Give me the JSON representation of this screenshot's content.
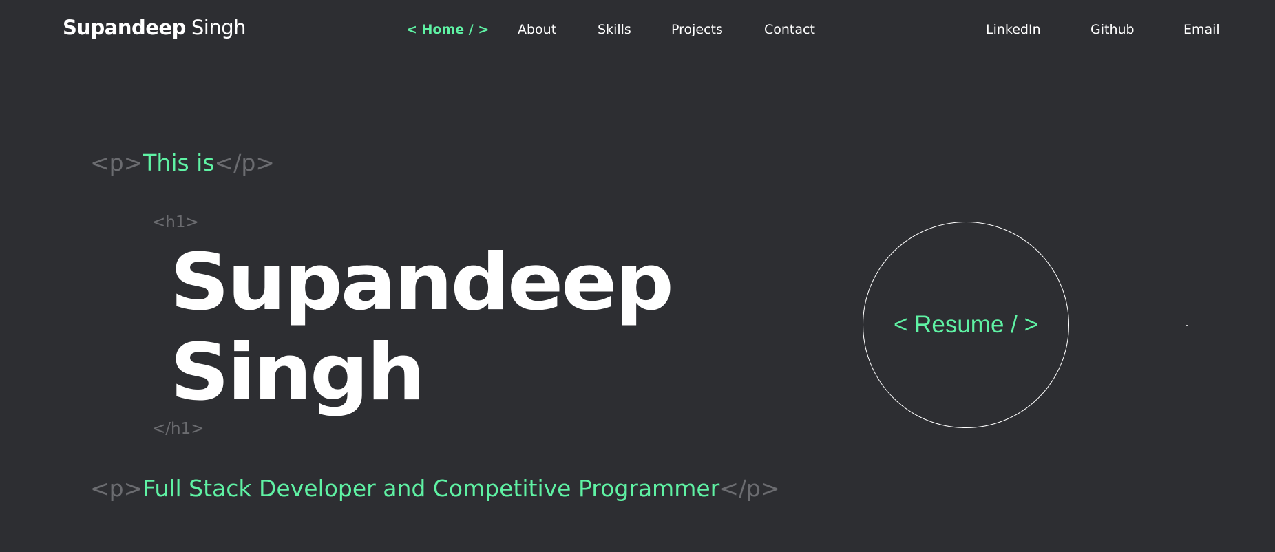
{
  "nav": {
    "brand_first": "Supandeep",
    "brand_last": "Singh",
    "links": [
      {
        "label": "< Home / >"
      },
      {
        "label": "About"
      },
      {
        "label": "Skills"
      },
      {
        "label": "Projects"
      },
      {
        "label": "Contact"
      }
    ],
    "social": [
      {
        "label": "LinkedIn"
      },
      {
        "label": "Github"
      },
      {
        "label": "Email"
      }
    ]
  },
  "hero": {
    "p_open": "<p>",
    "p_close": "</p>",
    "intro": "This is",
    "h1_open": "<h1>",
    "h1_close": "</h1>",
    "name_line1": "Supandeep",
    "name_line2": "Singh",
    "role": "Full Stack Developer and Competitive Programmer"
  },
  "resume": {
    "label": "< Resume / >"
  },
  "colors": {
    "background": "#2d2e32",
    "accent": "#5ff2a4",
    "tag": "#6b6c70",
    "text": "#ffffff"
  }
}
